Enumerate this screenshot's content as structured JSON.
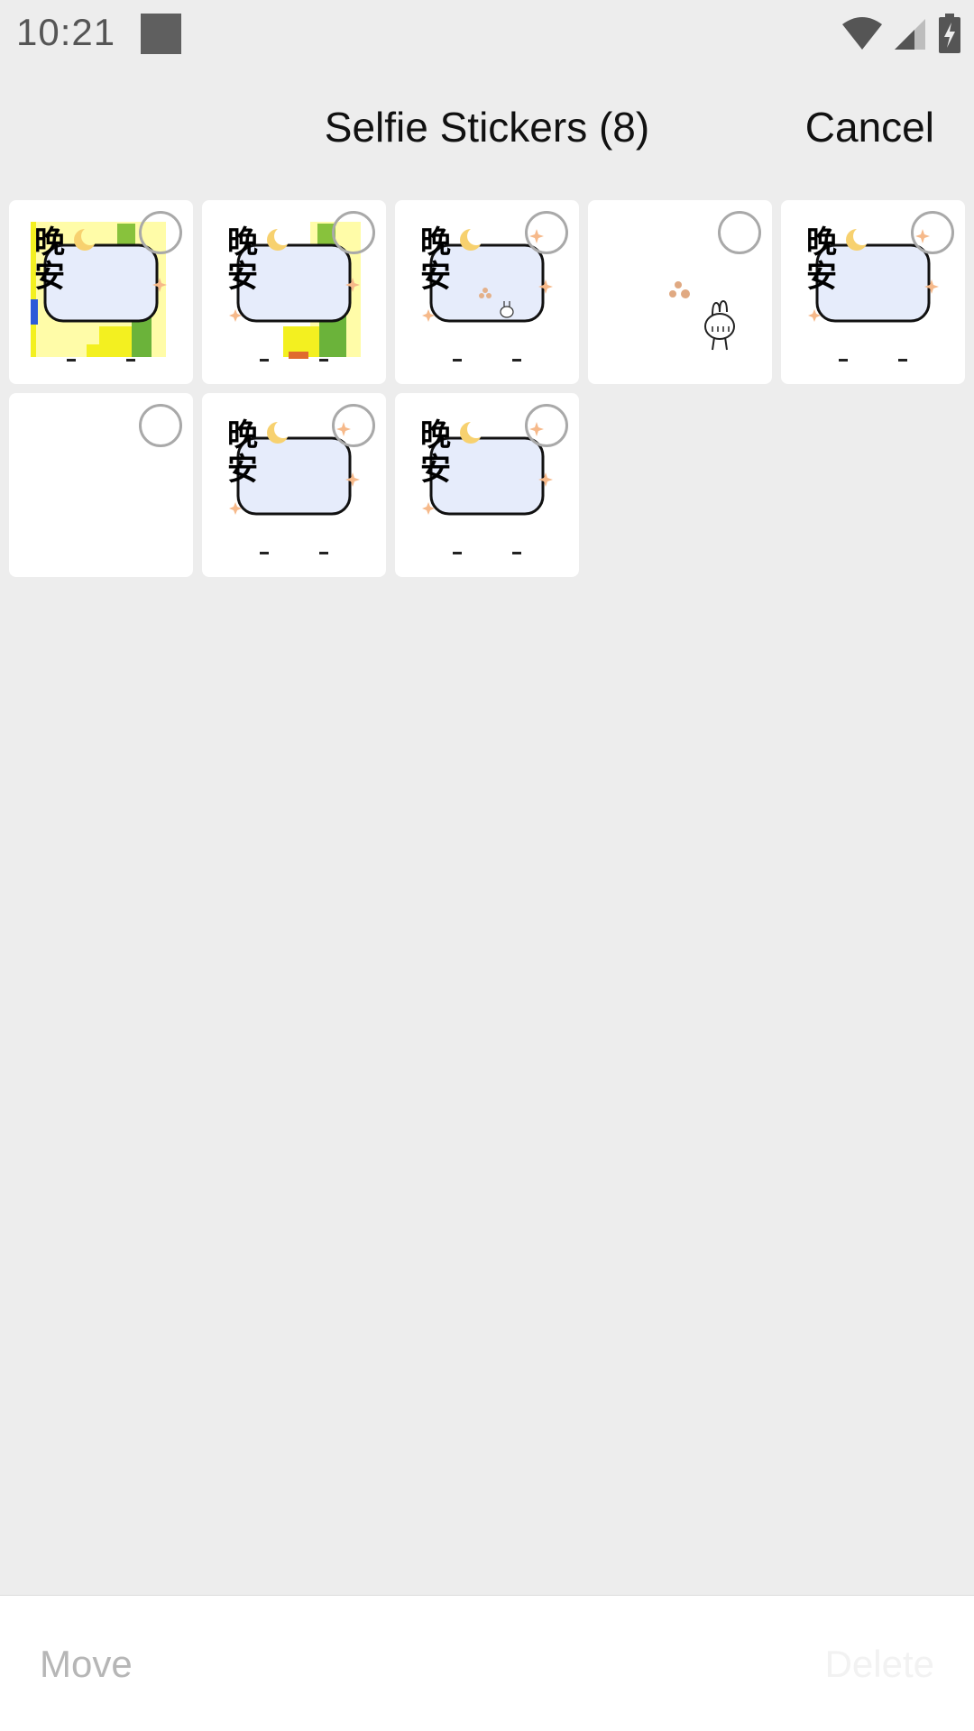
{
  "status_bar": {
    "time": "10:21",
    "icons": [
      "notification-square-icon",
      "wifi-icon",
      "cellular-signal-icon",
      "battery-charging-icon"
    ]
  },
  "header": {
    "title": "Selfie Stickers (8)",
    "cancel_label": "Cancel"
  },
  "stickers": [
    {
      "type": "goodnight",
      "text": "晚安",
      "background": "yellow-blocks"
    },
    {
      "type": "goodnight",
      "text": "晚安",
      "background": "yellow-green-blocks"
    },
    {
      "type": "goodnight",
      "text": "晚安",
      "background": "plain-with-bunny"
    },
    {
      "type": "bunny",
      "background": "plain"
    },
    {
      "type": "goodnight",
      "text": "晚安",
      "background": "plain"
    },
    {
      "type": "blank",
      "background": "plain"
    },
    {
      "type": "goodnight",
      "text": "晚安",
      "background": "plain"
    },
    {
      "type": "goodnight",
      "text": "晚安",
      "background": "plain"
    }
  ],
  "bottom_bar": {
    "move_label": "Move",
    "delete_label": "Delete"
  },
  "colors": {
    "background": "#ededed",
    "disabled_text": "#b6b6b6",
    "circle_border": "#a9a9a9",
    "moon": "#f7d16f",
    "bubble_fill": "#e6ecfb"
  }
}
